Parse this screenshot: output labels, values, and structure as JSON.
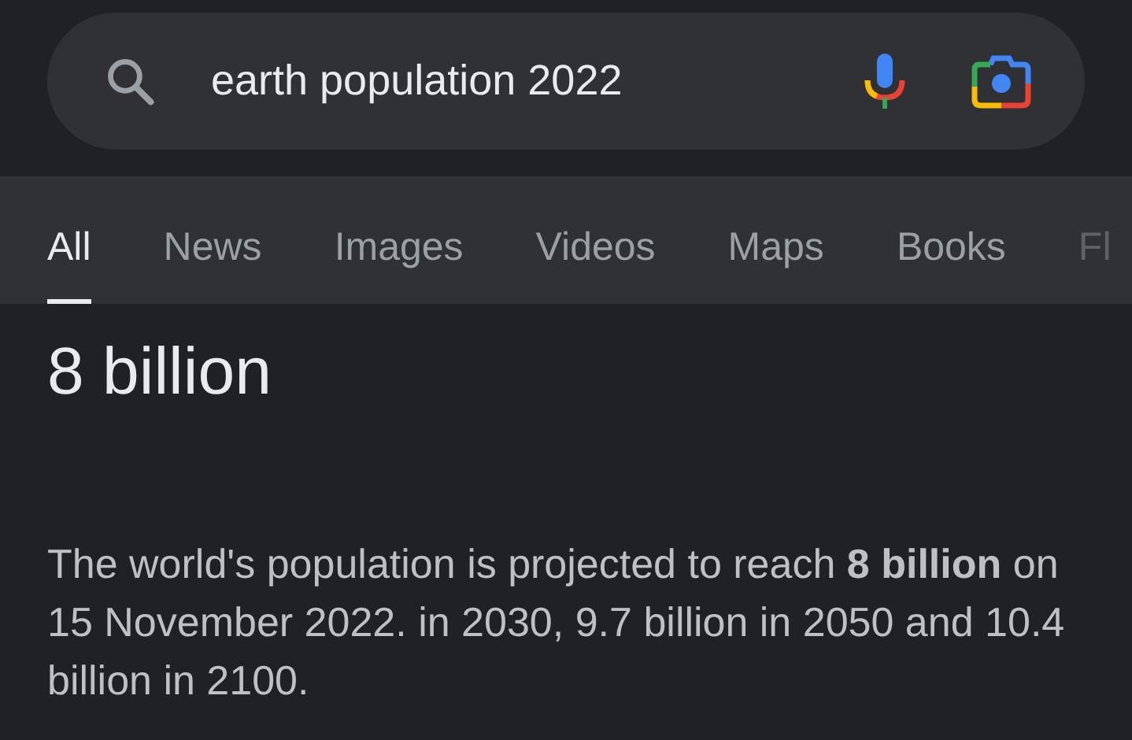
{
  "search": {
    "value": "earth population 2022"
  },
  "tabs": [
    {
      "label": "All",
      "selected": true
    },
    {
      "label": "News",
      "selected": false
    },
    {
      "label": "Images",
      "selected": false
    },
    {
      "label": "Videos",
      "selected": false
    },
    {
      "label": "Maps",
      "selected": false
    },
    {
      "label": "Books",
      "selected": false
    },
    {
      "label": "Fl",
      "selected": false,
      "faded": true
    }
  ],
  "answer": {
    "title": "8 billion",
    "text": "The world's population is projected to reach **8 billion** on 15 November 2022. in 2030, 9.7 billion in 2050 and 10.4 billion in 2100."
  }
}
